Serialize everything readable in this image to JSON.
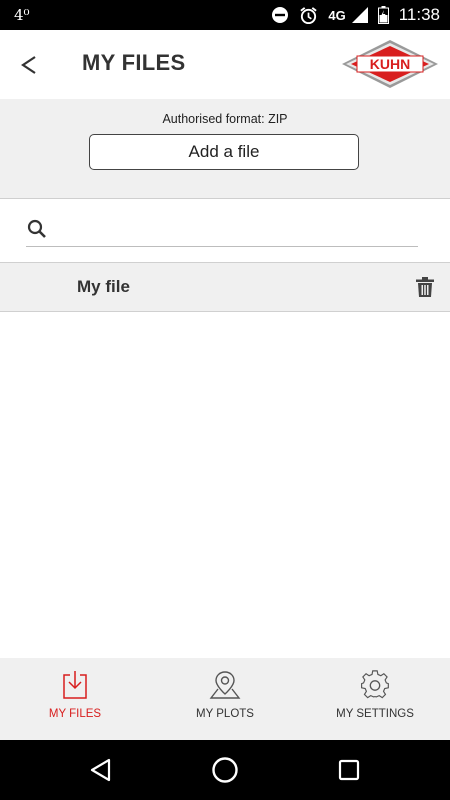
{
  "status": {
    "left_text": "4⁰",
    "network": "4G",
    "time": "11:38"
  },
  "header": {
    "back_label": "<",
    "title": "MY FILES",
    "logo_text": "KUHN"
  },
  "upload": {
    "format_note": "Authorised format: ZIP",
    "add_button": "Add a file"
  },
  "search": {
    "placeholder": "",
    "value": ""
  },
  "files": [
    {
      "name": "My file"
    }
  ],
  "bottom_nav": {
    "items": [
      {
        "label": "MY FILES",
        "icon": "download-icon",
        "active": true
      },
      {
        "label": "MY PLOTS",
        "icon": "map-pin-icon",
        "active": false
      },
      {
        "label": "MY SETTINGS",
        "icon": "gear-icon",
        "active": false
      }
    ]
  },
  "colors": {
    "accent": "#d81e1e",
    "panel": "#f0f0f0",
    "text": "#333333"
  }
}
